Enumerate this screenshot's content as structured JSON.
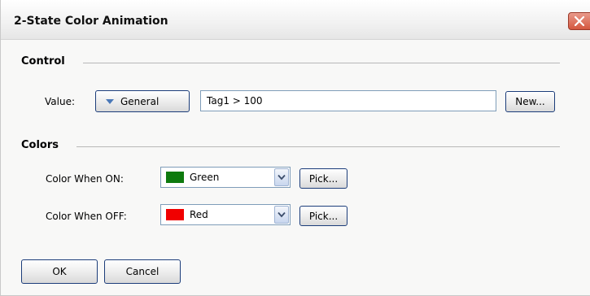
{
  "window": {
    "title": "2-State Color Animation"
  },
  "control": {
    "heading": "Control",
    "value_label": "Value:",
    "type_button": "General",
    "expression": "Tag1 > 100",
    "new_button": "New..."
  },
  "colors": {
    "heading": "Colors",
    "on": {
      "label": "Color When ON:",
      "value": "Green",
      "swatch": "#0e7a0e",
      "pick_button": "Pick..."
    },
    "off": {
      "label": "Color When OFF:",
      "value": "Red",
      "swatch": "#f00000",
      "pick_button": "Pick..."
    }
  },
  "footer": {
    "ok": "OK",
    "cancel": "Cancel"
  },
  "accent": {
    "close": "#d4573f",
    "button_border": "#1c3d7a"
  },
  "icons": [
    "close-icon",
    "dropdown-triangle-icon",
    "combo-arrow-icon"
  ]
}
